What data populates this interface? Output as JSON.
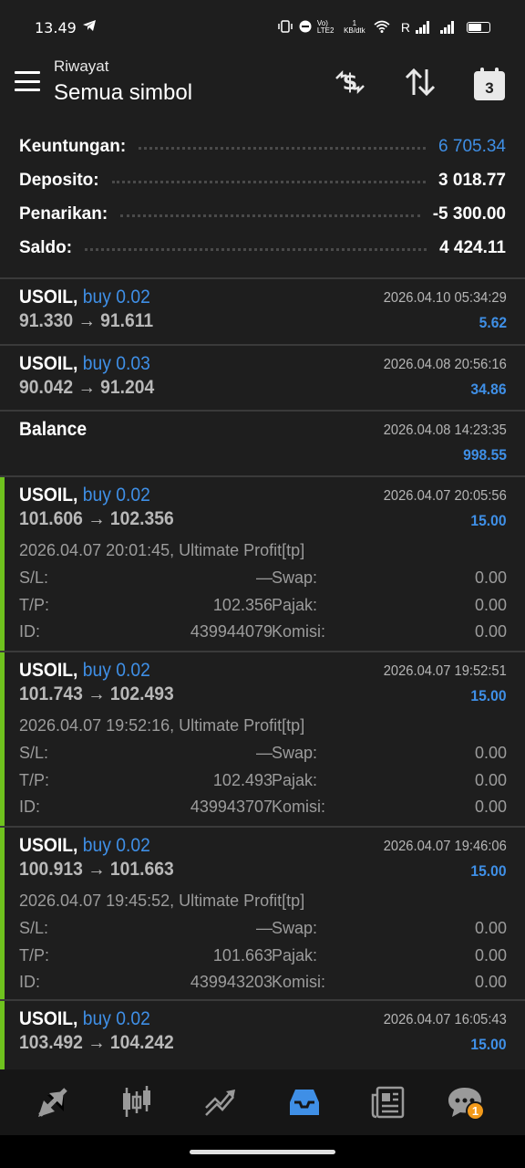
{
  "status": {
    "time": "13.49",
    "net_text": "Vo) LTE2",
    "speed": "1 KB/dtk",
    "roaming": "R"
  },
  "header": {
    "subtitle": "Riwayat",
    "title": "Semua simbol",
    "calendar_day": "3"
  },
  "summary": [
    {
      "label": "Keuntungan:",
      "value": "6 705.34",
      "highlight": true
    },
    {
      "label": "Deposito:",
      "value": "3 018.77",
      "highlight": false
    },
    {
      "label": "Penarikan:",
      "value": "-5 300.00",
      "highlight": false
    },
    {
      "label": "Saldo:",
      "value": "4 424.11",
      "highlight": false
    }
  ],
  "deals": [
    {
      "symbol": "USOIL,",
      "side": "buy 0.02",
      "time": "2026.04.10 05:34:29",
      "prices": "91.330 → 91.611",
      "profit": "5.62"
    },
    {
      "symbol": "USOIL,",
      "side": "buy 0.03",
      "time": "2026.04.08 20:56:16",
      "prices": "90.042 → 91.204",
      "profit": "34.86"
    },
    {
      "symbol": "Balance",
      "side": "",
      "time": "2026.04.08 14:23:35",
      "prices": "",
      "profit": "998.55"
    },
    {
      "symbol": "USOIL,",
      "side": "buy 0.02",
      "time": "2026.04.07 20:05:56",
      "prices": "101.606 → 102.356",
      "profit": "15.00",
      "comment": "2026.04.07 20:01:45, Ultimate Profit[tp]",
      "sl_label": "S/L:",
      "sl": "—",
      "swap_label": "Swap:",
      "swap": "0.00",
      "tp_label": "T/P:",
      "tp": "102.356",
      "tax_label": "Pajak:",
      "tax": "0.00",
      "id_label": "ID:",
      "id": "439944079",
      "comm_label": "Komisi:",
      "comm": "0.00"
    },
    {
      "symbol": "USOIL,",
      "side": "buy 0.02",
      "time": "2026.04.07 19:52:51",
      "prices": "101.743 → 102.493",
      "profit": "15.00",
      "comment": "2026.04.07 19:52:16, Ultimate Profit[tp]",
      "sl_label": "S/L:",
      "sl": "—",
      "swap_label": "Swap:",
      "swap": "0.00",
      "tp_label": "T/P:",
      "tp": "102.493",
      "tax_label": "Pajak:",
      "tax": "0.00",
      "id_label": "ID:",
      "id": "439943707",
      "comm_label": "Komisi:",
      "comm": "0.00"
    },
    {
      "symbol": "USOIL,",
      "side": "buy 0.02",
      "time": "2026.04.07 19:46:06",
      "prices": "100.913 → 101.663",
      "profit": "15.00",
      "comment": "2026.04.07 19:45:52, Ultimate Profit[tp]",
      "sl_label": "S/L:",
      "sl": "—",
      "swap_label": "Swap:",
      "swap": "0.00",
      "tp_label": "T/P:",
      "tp": "101.663",
      "tax_label": "Pajak:",
      "tax": "0.00",
      "id_label": "ID:",
      "id": "439943203",
      "comm_label": "Komisi:",
      "comm": "0.00"
    },
    {
      "symbol": "USOIL,",
      "side": "buy 0.02",
      "time": "2026.04.07 16:05:43",
      "prices": "103.492 → 104.242",
      "profit": "15.00"
    }
  ],
  "nav": {
    "active": "history-tab",
    "chat_badge": "1"
  },
  "colors": {
    "background": "#1e1e1e",
    "accent_blue": "#3f8fe6",
    "profit_border": "#6fc21e",
    "badge": "#f39a1a"
  }
}
